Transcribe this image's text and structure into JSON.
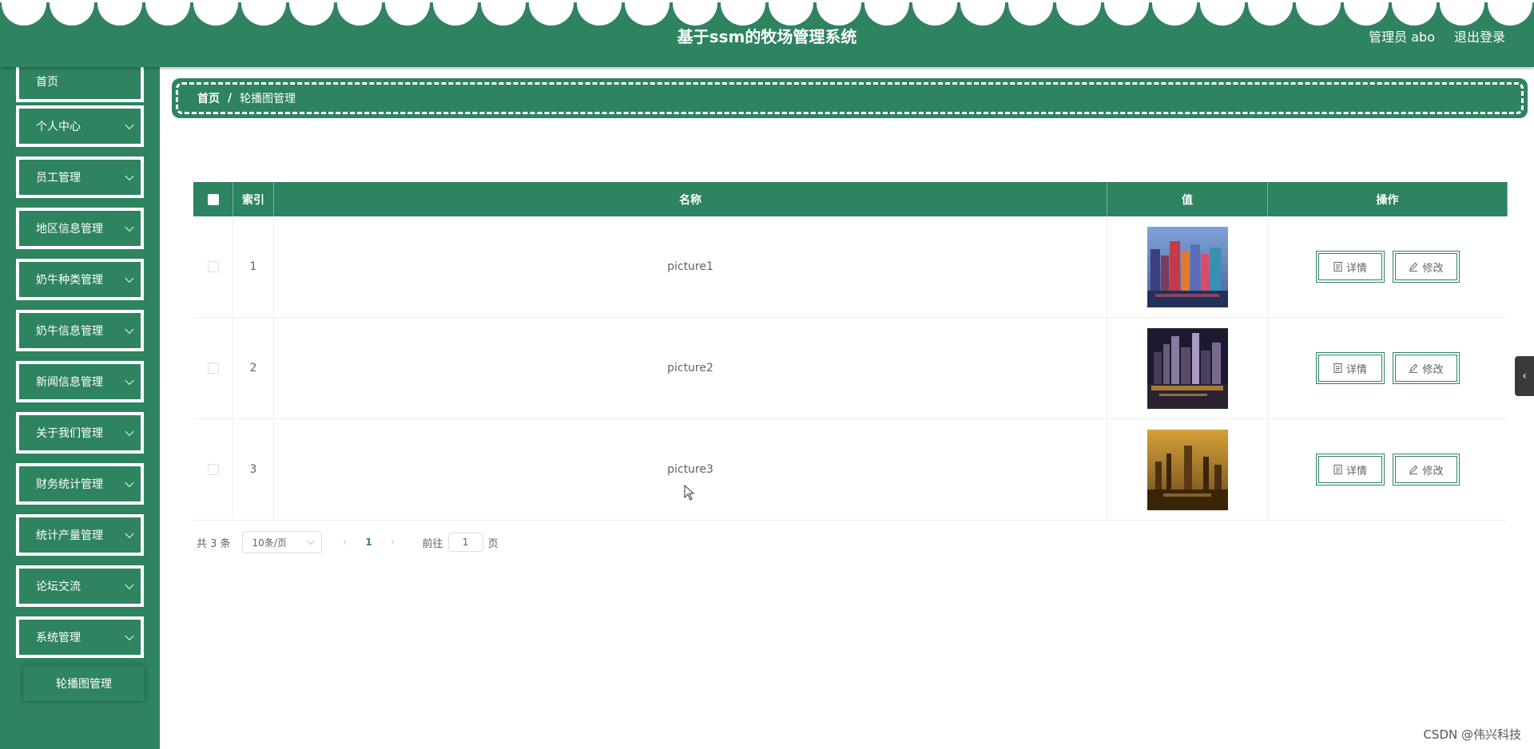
{
  "header": {
    "title": "基于ssm的牧场管理系统",
    "user_label": "管理员 abo",
    "logout_label": "退出登录"
  },
  "sidebar": {
    "items": [
      {
        "label": "首页",
        "has_arrow": false
      },
      {
        "label": "个人中心",
        "has_arrow": true
      },
      {
        "label": "员工管理",
        "has_arrow": true
      },
      {
        "label": "地区信息管理",
        "has_arrow": true
      },
      {
        "label": "奶牛种类管理",
        "has_arrow": true
      },
      {
        "label": "奶牛信息管理",
        "has_arrow": true
      },
      {
        "label": "新闻信息管理",
        "has_arrow": true
      },
      {
        "label": "关于我们管理",
        "has_arrow": true
      },
      {
        "label": "财务统计管理",
        "has_arrow": true
      },
      {
        "label": "统计产量管理",
        "has_arrow": true
      },
      {
        "label": "论坛交流",
        "has_arrow": true
      },
      {
        "label": "系统管理",
        "has_arrow": true
      }
    ],
    "sub_item": "轮播图管理"
  },
  "breadcrumb": {
    "home": "首页",
    "separator": "/",
    "current": "轮播图管理"
  },
  "table": {
    "headers": {
      "index": "索引",
      "name": "名称",
      "value": "值",
      "ops": "操作"
    },
    "rows": [
      {
        "index": "1",
        "name": "picture1"
      },
      {
        "index": "2",
        "name": "picture2"
      },
      {
        "index": "3",
        "name": "picture3"
      }
    ],
    "detail_label": "详情",
    "edit_label": "修改"
  },
  "pagination": {
    "total": "共 3 条",
    "page_size": "10条/页",
    "current_page": "1",
    "goto_label": "前往",
    "goto_value": "1",
    "page_suffix": "页"
  },
  "watermark": "CSDN @伟兴科技",
  "colors": {
    "primary": "#2e8361",
    "border": "#ebeef5"
  }
}
